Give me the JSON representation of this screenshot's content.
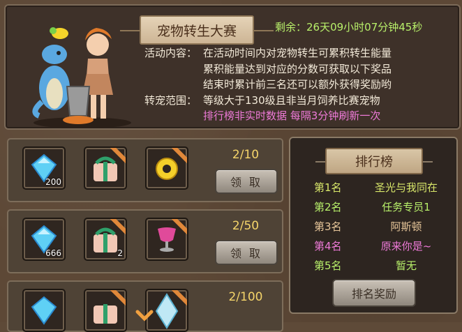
{
  "event": {
    "title": "宠物转生大赛",
    "remaining": "剩余：26天09小时07分钟45秒",
    "desc_label": "活动内容：",
    "desc_lines": [
      "在活动时间内对宠物转生可累积转生能量",
      "累积能量达到对应的分数可获取以下奖品",
      "结束时累计前三名还可以额外获得奖励哟"
    ],
    "range_label": "转宠范围：",
    "range_text": "等级大于130级且非当月饲养比赛宠物",
    "notice": "排行榜非实时数据  每隔3分钟刷新一次"
  },
  "rewards": [
    {
      "progress": "2/10",
      "claim_label": "领 取",
      "items": [
        {
          "icon": "blue-diamond-icon",
          "count": "200"
        },
        {
          "icon": "gift-box-icon",
          "count": ""
        },
        {
          "icon": "gold-ring-icon",
          "count": ""
        }
      ]
    },
    {
      "progress": "2/50",
      "claim_label": "领 取",
      "items": [
        {
          "icon": "blue-diamond-icon",
          "count": "666"
        },
        {
          "icon": "gift-box-icon",
          "count": "2"
        },
        {
          "icon": "goblet-icon",
          "count": ""
        }
      ]
    },
    {
      "progress": "2/100",
      "claim_label": "",
      "items": [
        {
          "icon": "blue-diamond-icon",
          "count": ""
        },
        {
          "icon": "gift-box-icon",
          "count": ""
        },
        {
          "icon": "crystal-icon",
          "count": ""
        }
      ]
    }
  ],
  "ranking": {
    "title": "排行榜",
    "entries": [
      {
        "pos": "第1名",
        "name": "圣光与我同在",
        "color": "#d9e86a"
      },
      {
        "pos": "第2名",
        "name": "任务专员1",
        "color": "#b8f06a"
      },
      {
        "pos": "第3名",
        "name": "阿斯顿",
        "color": "#e8c79a"
      },
      {
        "pos": "第4名",
        "name": "原来你是~",
        "color": "#ee7ad8"
      },
      {
        "pos": "第5名",
        "name": "暂无",
        "color": "#b8f06a"
      }
    ],
    "reward_button": "排名奖励"
  }
}
